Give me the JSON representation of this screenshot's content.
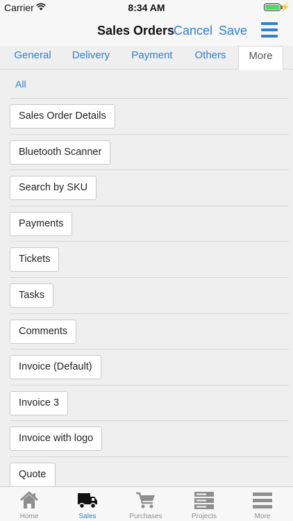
{
  "status_bar": {
    "carrier": "Carrier",
    "time": "8:34 AM",
    "battery_level": 1.0
  },
  "nav": {
    "title": "Sales Orders",
    "cancel": "Cancel",
    "save": "Save"
  },
  "tabs": [
    {
      "label": "General",
      "active": false
    },
    {
      "label": "Delivery",
      "active": false
    },
    {
      "label": "Payment",
      "active": false
    },
    {
      "label": "Others",
      "active": false
    },
    {
      "label": "More",
      "active": true
    }
  ],
  "filter": {
    "all": "All"
  },
  "items": [
    {
      "label": "Sales Order Details"
    },
    {
      "label": "Bluetooth Scanner"
    },
    {
      "label": "Search by SKU"
    },
    {
      "label": "Payments"
    },
    {
      "label": "Tickets"
    },
    {
      "label": "Tasks"
    },
    {
      "label": "Comments"
    },
    {
      "label": "Invoice (Default)"
    },
    {
      "label": "Invoice 3"
    },
    {
      "label": "Invoice with logo"
    },
    {
      "label": "Quote"
    }
  ],
  "tab_bar": [
    {
      "label": "Home",
      "icon": "home-icon",
      "active": false
    },
    {
      "label": "Sales",
      "icon": "truck-icon",
      "active": true
    },
    {
      "label": "Purchases",
      "icon": "cart-icon",
      "active": false
    },
    {
      "label": "Projects",
      "icon": "server-icon",
      "active": false
    },
    {
      "label": "More",
      "icon": "menu-icon",
      "active": false
    }
  ],
  "colors": {
    "accent": "#2f7fd0",
    "inactive": "#8e8e8e",
    "battery": "#4cd964"
  }
}
